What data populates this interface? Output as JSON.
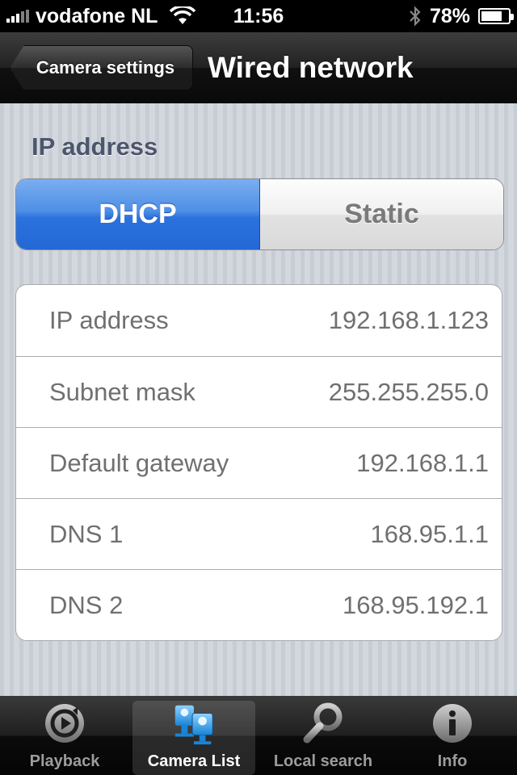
{
  "status_bar": {
    "carrier": "vodafone NL",
    "time": "11:56",
    "battery": "78%",
    "battery_level": 0.78
  },
  "nav": {
    "back_label": "Camera settings",
    "title": "Wired network"
  },
  "section": {
    "label": "IP address"
  },
  "segmented": {
    "options": [
      "DHCP",
      "Static"
    ],
    "selected": "DHCP"
  },
  "network": {
    "rows": [
      {
        "label": "IP address",
        "value": "192.168.1.123"
      },
      {
        "label": "Subnet mask",
        "value": "255.255.255.0"
      },
      {
        "label": "Default gateway",
        "value": "192.168.1.1"
      },
      {
        "label": "DNS 1",
        "value": "168.95.1.1"
      },
      {
        "label": "DNS 2",
        "value": "168.95.192.1"
      }
    ]
  },
  "tabs": [
    {
      "label": "Playback",
      "icon": "playback-icon",
      "active": false
    },
    {
      "label": "Camera List",
      "icon": "camera-list-icon",
      "active": true
    },
    {
      "label": "Local search",
      "icon": "search-icon",
      "active": false
    },
    {
      "label": "Info",
      "icon": "info-icon",
      "active": false
    }
  ],
  "colors": {
    "selected_segment": "#2b72dd",
    "section_label": "#4c566c",
    "cell_text": "#707070"
  }
}
